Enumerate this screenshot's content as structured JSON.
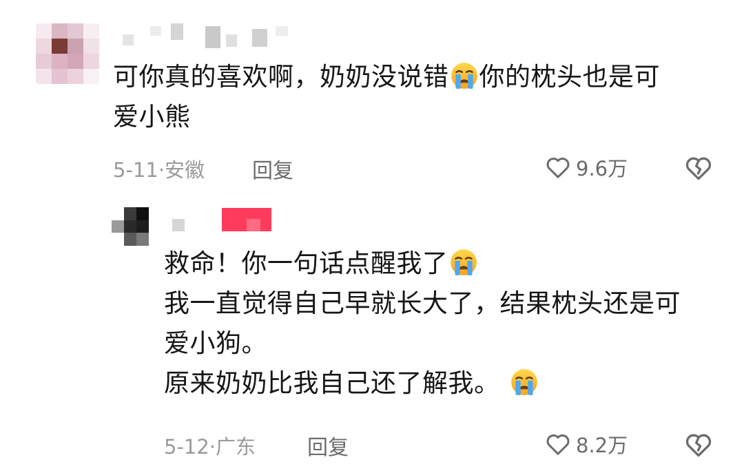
{
  "comments": [
    {
      "text_lines": [
        "可你真的喜欢啊，奶奶没说错",
        "你的枕头也是可",
        "爱小熊"
      ],
      "date": "5-11",
      "location": "安徽",
      "reply_label": "回复",
      "likes": "9.6万",
      "reaction_icon": "crying-face-emoji"
    },
    {
      "text_lines": [
        "救命！你一句话点醒我了",
        "我一直觉得自己早就长大了，结果枕头还是可",
        "爱小狗。",
        "原来奶奶比我自己还了解我。"
      ],
      "date": "5-12",
      "location": "广东",
      "reply_label": "回复",
      "likes": "8.2万",
      "reaction_icon": "crying-face-emoji"
    }
  ],
  "colors": {
    "text": "#161616",
    "meta": "#9a9a9a",
    "action": "#6b6b6b",
    "name_tag": "#ff3b5c"
  },
  "icons": [
    "heart-outline-icon",
    "broken-heart-icon",
    "crying-face-emoji"
  ]
}
